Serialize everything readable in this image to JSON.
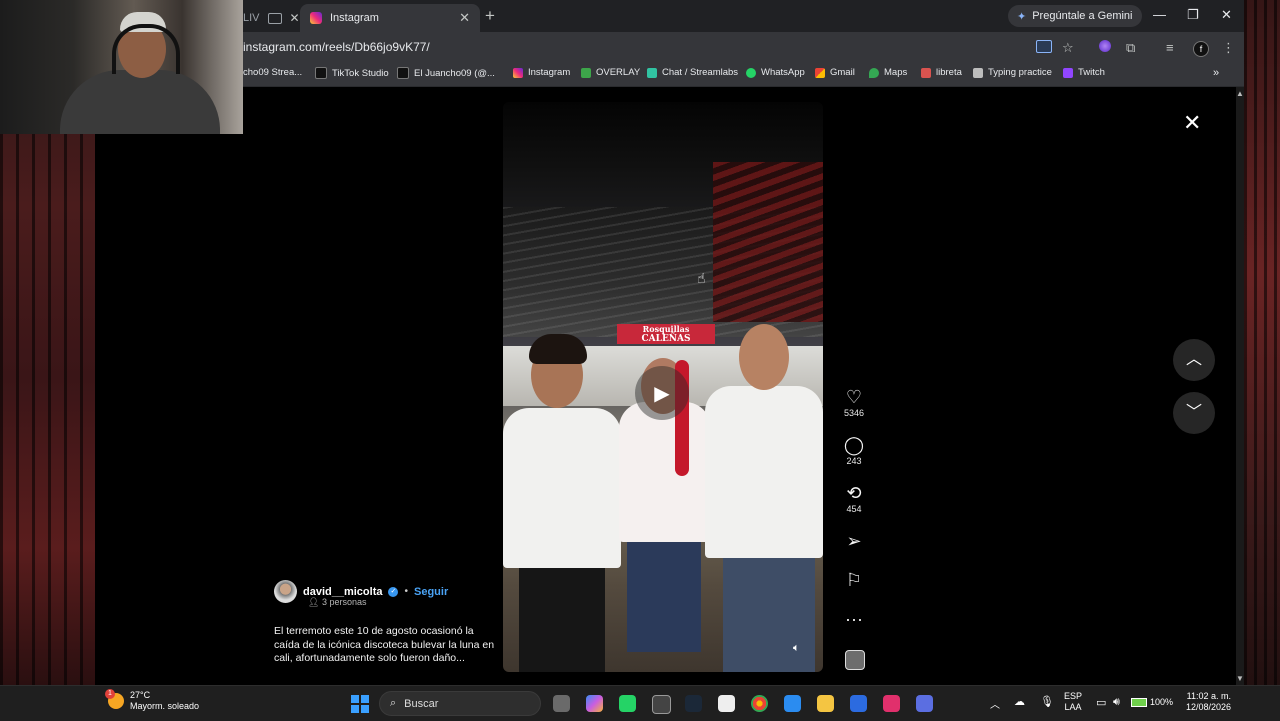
{
  "browser": {
    "tabs": [
      {
        "label": "LIV",
        "active": false
      },
      {
        "label": "Instagram",
        "active": true
      }
    ],
    "gemini_label": "Pregúntale a Gemini",
    "url": "instagram.com/reels/Db66jo9vK77/",
    "bookmarks": [
      {
        "label": "cho09 Strea..."
      },
      {
        "label": "TikTok Studio"
      },
      {
        "label": "El Juancho09 (@..."
      },
      {
        "label": "Instagram"
      },
      {
        "label": "OVERLAY"
      },
      {
        "label": "Chat / Streamlabs"
      },
      {
        "label": "WhatsApp"
      },
      {
        "label": "Gmail"
      },
      {
        "label": "Maps"
      },
      {
        "label": "libreta"
      },
      {
        "label": "Typing practice"
      },
      {
        "label": "Twitch"
      }
    ]
  },
  "reel": {
    "sign_text_1": "Rosquillas",
    "sign_text_2": "CALEÑAS",
    "likes": "5346",
    "comments": "243",
    "reposts": "454",
    "username": "david__micolta",
    "follow": "Seguir",
    "people": "3 personas",
    "caption": "El terremoto este 10 de agosto ocasionó la caída de la icónica discoteca bulevar la luna en cali, afortunadamente solo fueron daño..."
  },
  "taskbar": {
    "temp": "27°C",
    "weather": "Mayorm. soleado",
    "weather_badge": "1",
    "search": "Buscar",
    "lang_1": "ESP",
    "lang_2": "LAA",
    "battery": "100%",
    "time": "11:02 a. m.",
    "date": "12/08/2026"
  },
  "colors": {
    "accent": "#4aa3f5",
    "tab_bg": "#35363a",
    "window_bg": "#202124"
  }
}
